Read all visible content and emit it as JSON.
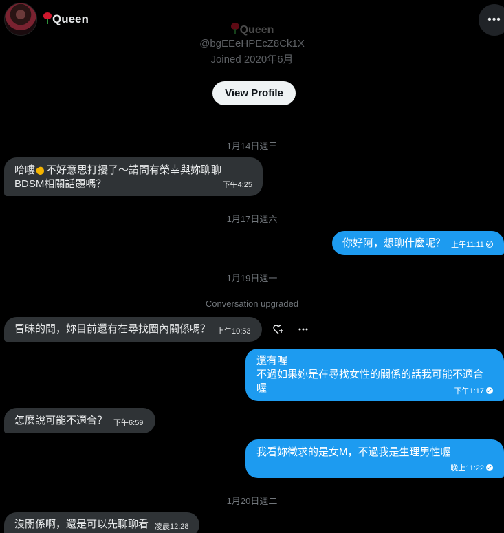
{
  "header": {
    "name": "Queen",
    "more_label": "•••"
  },
  "profile": {
    "name": "Queen",
    "handle": "@bgEEeHPEcZ8Ck1X",
    "joined": "Joined 2020年6月",
    "view_profile_label": "View Profile"
  },
  "dates": {
    "d1": "1月14日週三",
    "d2": "1月17日週六",
    "d3": "1月19日週一",
    "d4": "1月20日週二"
  },
  "system": {
    "upgraded": "Conversation upgraded"
  },
  "messages": {
    "m1": {
      "text_a": "哈嘍",
      "text_b": "不好意思打擾了～請問有榮幸與妳聊聊",
      "text_c": "BDSM相關話題嗎？",
      "time": "下午4:25"
    },
    "m2": {
      "text": "你好阿，想聊什麼呢？",
      "time": "上午11:11"
    },
    "m3": {
      "text": "冒昧的問，妳目前還有在尋找圈內關係嗎？",
      "time": "上午10:53"
    },
    "m4": {
      "line1": "還有喔",
      "line2": "不過如果妳是在尋找女性的關係的話我可能不適合",
      "line3": "喔",
      "time": "下午1:17"
    },
    "m5": {
      "text": "怎麼說可能不適合？",
      "time": "下午6:59"
    },
    "m6": {
      "text": "我看妳徵求的是女M，不過我是生理男性喔",
      "time": "晚上11:22"
    },
    "m7": {
      "text": "沒關係啊，還是可以先聊聊看",
      "time": "凌晨12:28"
    }
  },
  "icons": {
    "wave": "waving-hand-icon",
    "rose": "rose-icon",
    "react": "add-reaction-icon",
    "more": "more-options-icon",
    "check": "sent-check-icon"
  },
  "colors": {
    "sent_bubble": "#1d9bf0",
    "recv_bubble": "#2f3336",
    "background": "#000000"
  }
}
